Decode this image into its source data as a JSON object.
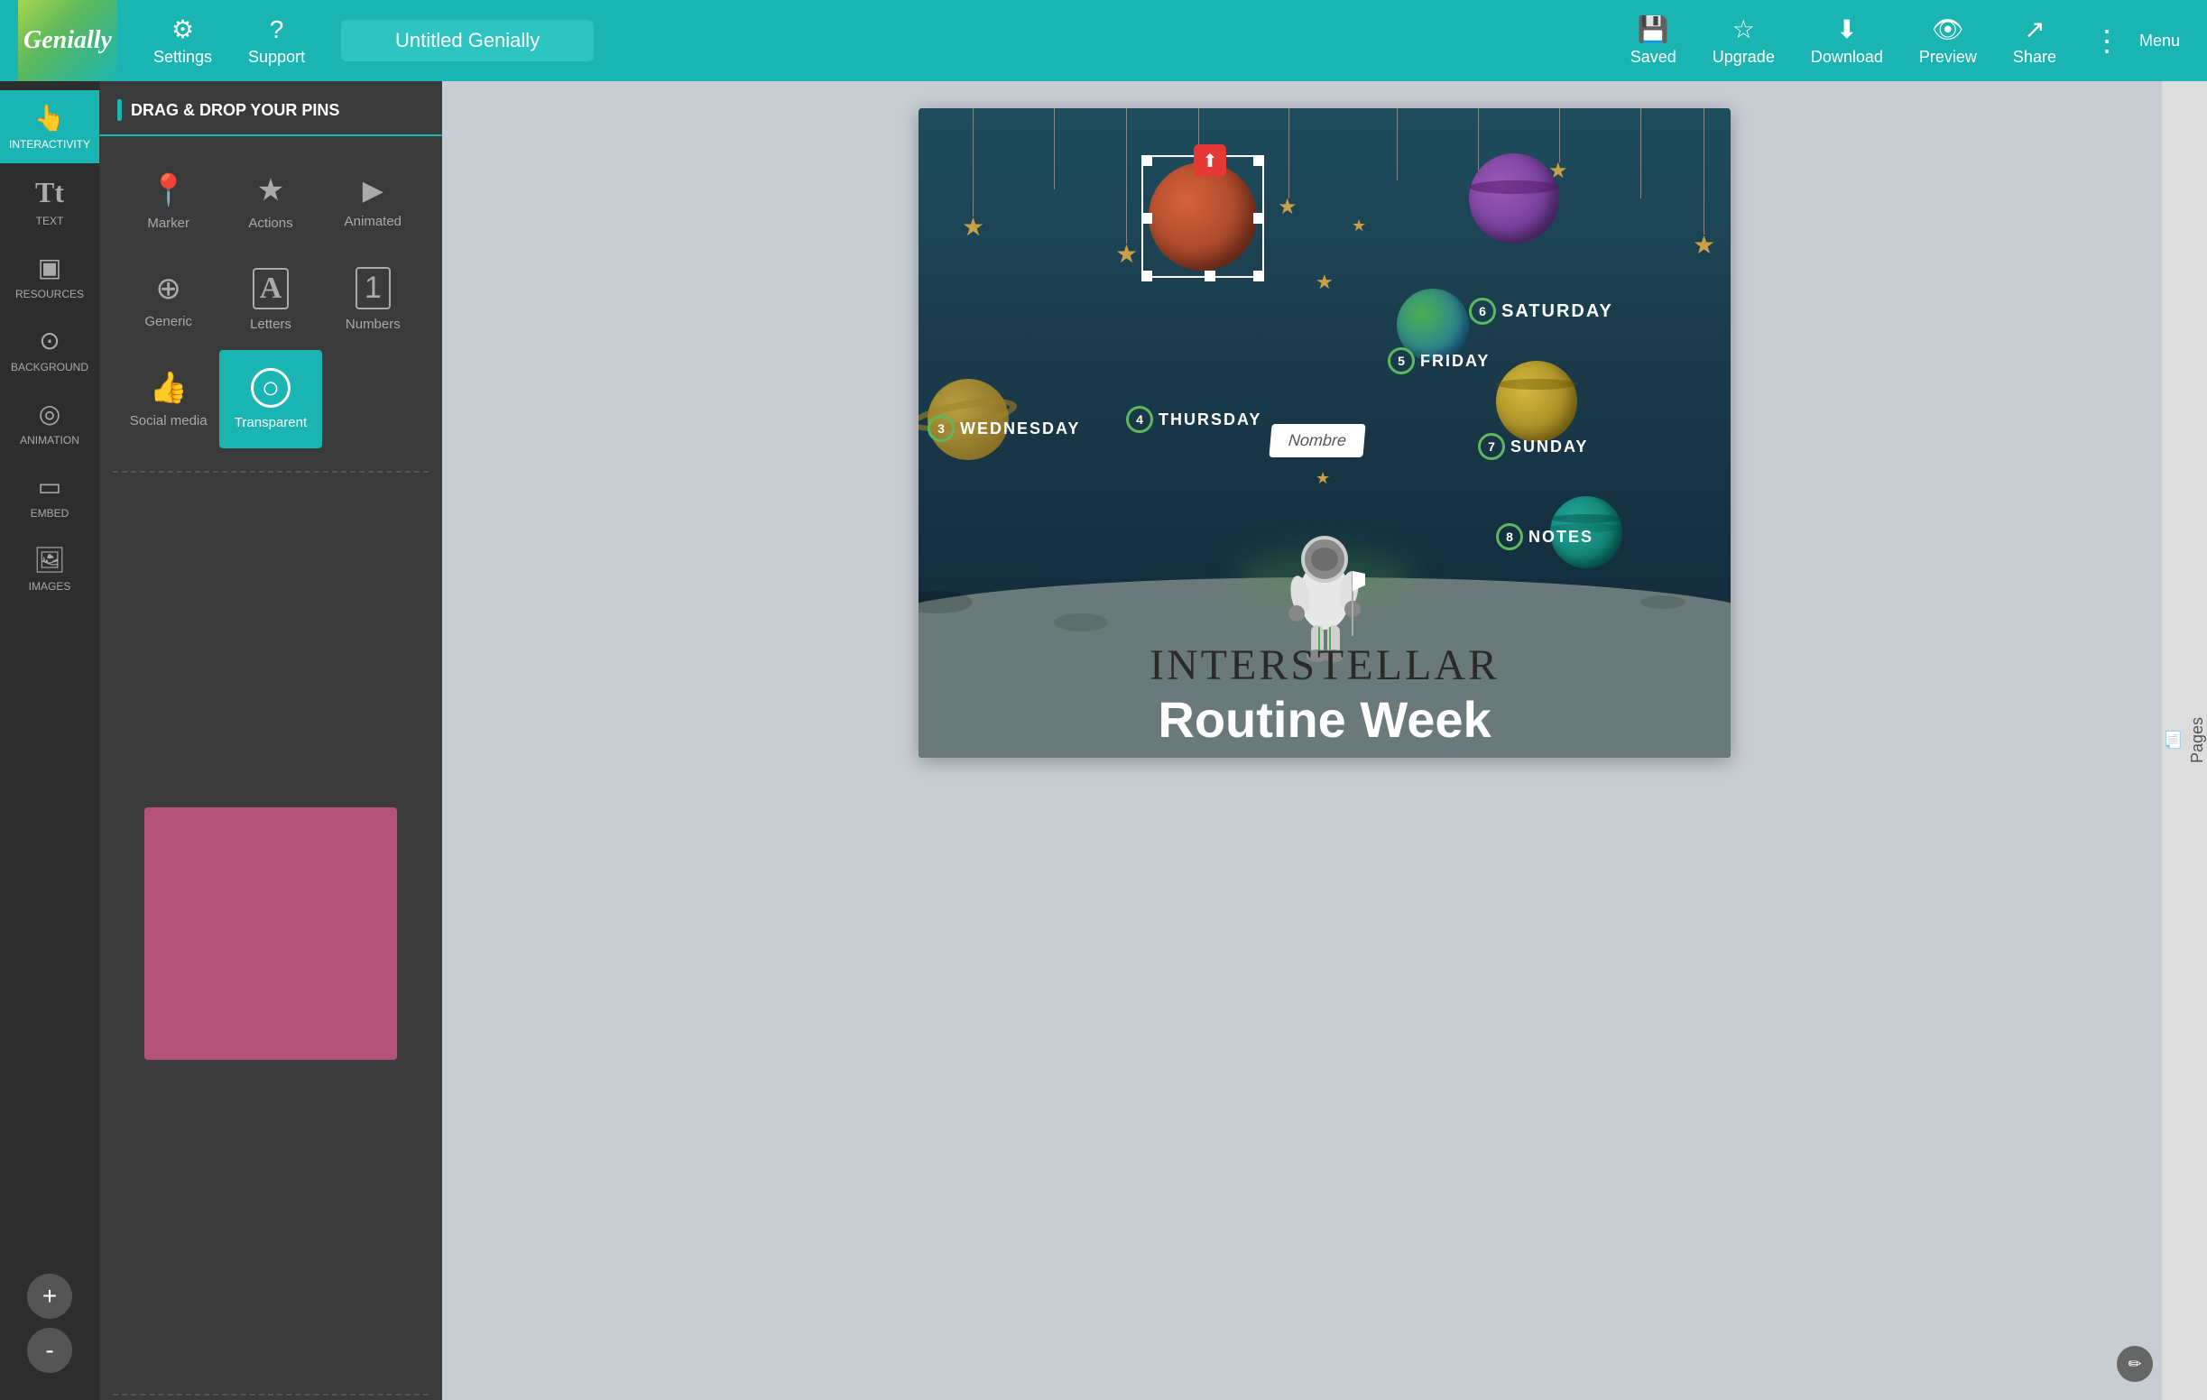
{
  "app": {
    "logo": "Genially",
    "title_input": "Untitled Genially"
  },
  "nav": {
    "settings_label": "Settings",
    "support_label": "Support",
    "saved_label": "Saved",
    "upgrade_label": "Upgrade",
    "download_label": "Download",
    "preview_label": "Preview",
    "share_label": "Share",
    "menu_label": "Menu"
  },
  "sidebar": {
    "items": [
      {
        "id": "interactivity",
        "label": "INTERACTIVITY",
        "icon": "👆",
        "active": true
      },
      {
        "id": "text",
        "label": "TEXT",
        "icon": "T"
      },
      {
        "id": "resources",
        "label": "RESOURCES",
        "icon": "▣"
      },
      {
        "id": "background",
        "label": "BACKGROUND",
        "icon": "⊙"
      },
      {
        "id": "animation",
        "label": "ANIMATION",
        "icon": "◎"
      },
      {
        "id": "embed",
        "label": "EMBED",
        "icon": "▭"
      },
      {
        "id": "images",
        "label": "IMAGES",
        "icon": "🖼"
      }
    ]
  },
  "panel": {
    "header": "DRAG & DROP YOUR PINS",
    "pins": [
      {
        "id": "marker",
        "label": "Marker",
        "icon": "📍"
      },
      {
        "id": "actions",
        "label": "Actions",
        "icon": "★"
      },
      {
        "id": "animated",
        "label": "Animated",
        "icon": "▶"
      },
      {
        "id": "generic",
        "label": "Generic",
        "icon": "+"
      },
      {
        "id": "letters",
        "label": "Letters",
        "icon": "A"
      },
      {
        "id": "numbers",
        "label": "Numbers",
        "icon": "1"
      },
      {
        "id": "social_media",
        "label": "Social media",
        "icon": "👍"
      },
      {
        "id": "transparent",
        "label": "Transparent",
        "icon": "○",
        "active": true
      }
    ]
  },
  "canvas": {
    "title1": "INTERSTELLAR",
    "title2": "Routine Week",
    "days": [
      {
        "num": "3",
        "label": "Wednesday"
      },
      {
        "num": "4",
        "label": "Thursday"
      },
      {
        "num": "5",
        "label": "Friday"
      },
      {
        "num": "6",
        "label": "Saturday"
      },
      {
        "num": "7",
        "label": "Sunday"
      },
      {
        "num": "8",
        "label": "Notes"
      }
    ],
    "nombre_label": "Nombre"
  },
  "pages_sidebar": {
    "label": "Pages"
  },
  "zoom": {
    "add_label": "+",
    "minus_label": "-"
  }
}
